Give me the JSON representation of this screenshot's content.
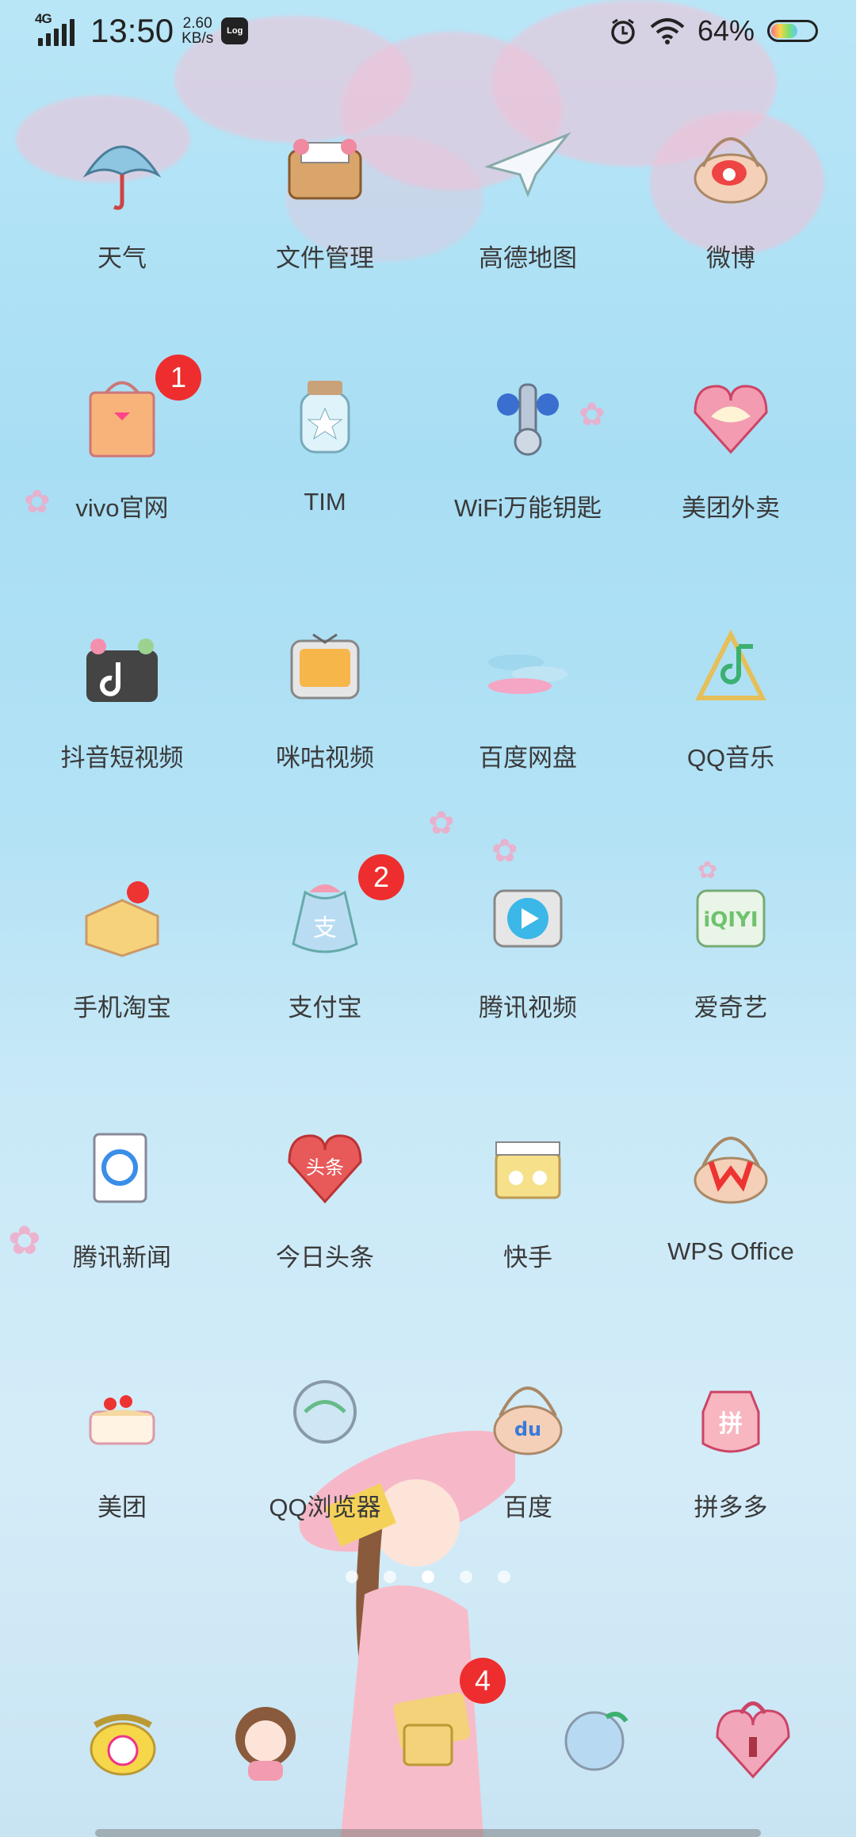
{
  "status_bar": {
    "network_type": "4G",
    "network_speed_value": "2.60",
    "network_speed_unit": "KB/s",
    "time": "13:50",
    "log_label": "Log",
    "battery_percent_text": "64%",
    "battery_level": 0.64
  },
  "apps": [
    {
      "label": "天气",
      "icon": "umbrella-icon"
    },
    {
      "label": "文件管理",
      "icon": "file-basket-icon"
    },
    {
      "label": "高德地图",
      "icon": "paper-crane-icon"
    },
    {
      "label": "微博",
      "icon": "weibo-basket-icon"
    },
    {
      "label": "vivo官网",
      "icon": "gift-bag-icon",
      "badge": "1"
    },
    {
      "label": "TIM",
      "icon": "star-jar-icon"
    },
    {
      "label": "WiFi万能钥匙",
      "icon": "key-flower-icon"
    },
    {
      "label": "美团外卖",
      "icon": "heart-kangaroo-icon"
    },
    {
      "label": "抖音短视频",
      "icon": "tiktok-note-icon"
    },
    {
      "label": "咪咕视频",
      "icon": "retro-tv-icon"
    },
    {
      "label": "百度网盘",
      "icon": "cloud-icon"
    },
    {
      "label": "QQ音乐",
      "icon": "music-note-icon"
    },
    {
      "label": "手机淘宝",
      "icon": "gift-box-icon"
    },
    {
      "label": "支付宝",
      "icon": "alipay-pouch-icon",
      "badge": "2"
    },
    {
      "label": "腾讯视频",
      "icon": "play-tv-icon"
    },
    {
      "label": "爱奇艺",
      "icon": "iqiyi-tv-icon"
    },
    {
      "label": "腾讯新闻",
      "icon": "news-book-icon"
    },
    {
      "label": "今日头条",
      "icon": "toutiao-heart-icon"
    },
    {
      "label": "快手",
      "icon": "kuaishou-clapper-icon"
    },
    {
      "label": "WPS Office",
      "icon": "wps-basket-icon"
    },
    {
      "label": "美团",
      "icon": "cake-icon"
    },
    {
      "label": "QQ浏览器",
      "icon": "globe-icon"
    },
    {
      "label": "百度",
      "icon": "baidu-basket-icon"
    },
    {
      "label": "拼多多",
      "icon": "pinduoduo-jar-icon"
    }
  ],
  "page_indicator": {
    "count": 5,
    "active": 2
  },
  "dock": [
    {
      "icon": "telephone-icon"
    },
    {
      "icon": "girl-avatar-icon"
    },
    {
      "icon": "message-bag-icon",
      "badge": "4"
    },
    {
      "icon": "globe-browser-icon"
    },
    {
      "icon": "heart-lock-icon"
    }
  ],
  "colors": {
    "badge": "#ee2e2e",
    "label_text": "#3a3a3a",
    "sky": "#a8def4",
    "blossom": "#f2c1d6"
  }
}
